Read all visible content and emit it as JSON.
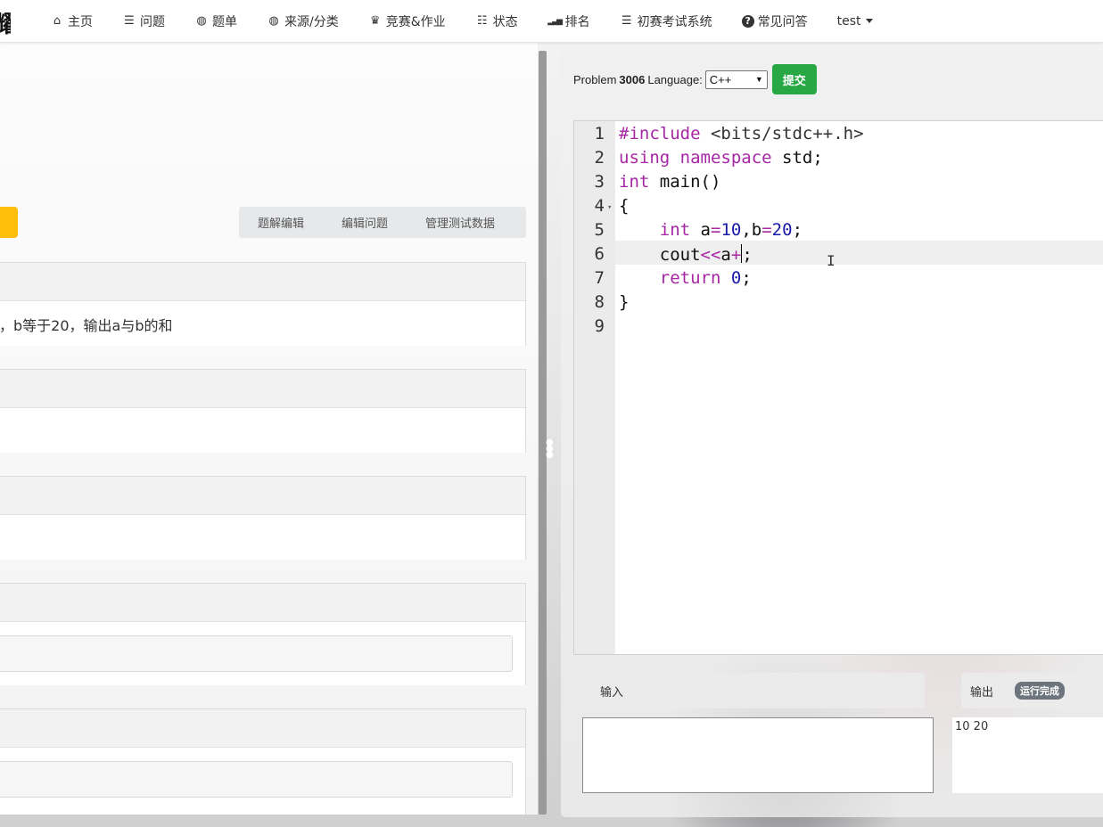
{
  "navbar": {
    "brand_char": "耀",
    "items": [
      {
        "label": "主页",
        "icon": "home-icon",
        "glyph": "⌂"
      },
      {
        "label": "问题",
        "icon": "list-icon",
        "glyph": "☰"
      },
      {
        "label": "题单",
        "icon": "globe-icon",
        "glyph": "◍"
      },
      {
        "label": "来源/分类",
        "icon": "globe-icon",
        "glyph": "◍"
      },
      {
        "label": "竞赛&作业",
        "icon": "trophy-icon",
        "glyph": "♛"
      },
      {
        "label": "状态",
        "icon": "checklist-icon",
        "glyph": "☷"
      },
      {
        "label": "排名",
        "icon": "signal-icon",
        "glyph": "▂▃▅"
      },
      {
        "label": "初赛考试系统",
        "icon": "list-icon",
        "glyph": "☰"
      },
      {
        "label": "常见问答",
        "icon": "question-circle-icon",
        "glyph": "?"
      }
    ],
    "user": "test"
  },
  "problem_actions": {
    "solution_edit": "题解编辑",
    "edit_problem": "编辑问题",
    "manage_testdata": "管理测试数据"
  },
  "description": {
    "text": "，b等于20，输出a与b的和"
  },
  "toolbar": {
    "problem_label": "Problem",
    "problem_id": "3006",
    "language_label": "Language:",
    "language_value": "C++",
    "submit_label": "提交"
  },
  "editor": {
    "line_numbers": [
      "1",
      "2",
      "3",
      "4",
      "5",
      "6",
      "7",
      "8",
      "9"
    ],
    "active_line": 6
  },
  "io": {
    "input_label": "输入",
    "output_label": "输出",
    "status": "运行完成",
    "output_value": "10 20"
  },
  "colors": {
    "submit_green": "#28a745",
    "accent_orange": "#ffbe0b",
    "keyword_purple": "#a626a4",
    "number_blue": "#1a1aa6"
  }
}
